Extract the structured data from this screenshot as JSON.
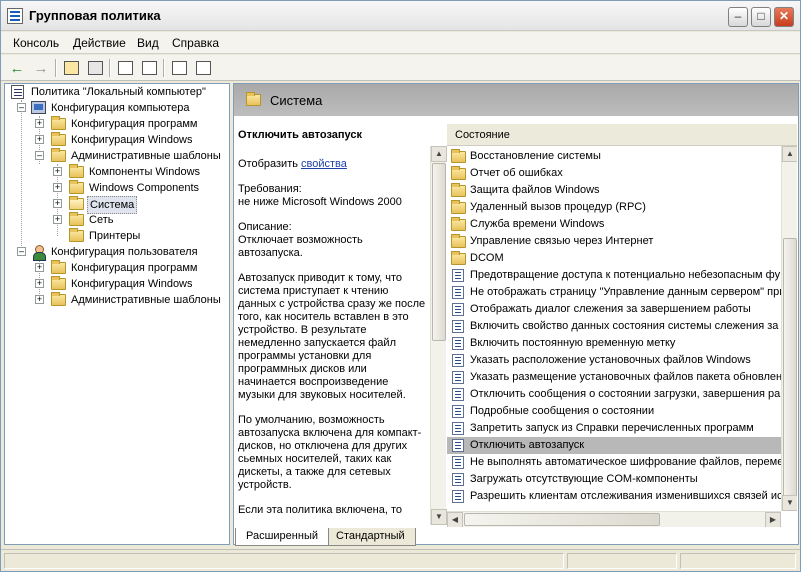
{
  "window": {
    "title": "Групповая политика"
  },
  "menu": {
    "items": [
      "Консоль",
      "Действие",
      "Вид",
      "Справка"
    ]
  },
  "tree": {
    "root": "Политика \"Локальный компьютер\"",
    "computer_config": "Конфигурация компьютера",
    "cc_programs": "Конфигурация программ",
    "cc_windows": "Конфигурация Windows",
    "cc_admin": "Административные шаблоны",
    "admin_components": "Компоненты Windows",
    "admin_windows_components": "Windows Components",
    "admin_system": "Система",
    "admin_network": "Сеть",
    "admin_printers": "Принтеры",
    "user_config": "Конфигурация пользователя",
    "uc_programs": "Конфигурация программ",
    "uc_windows": "Конфигурация Windows",
    "uc_admin": "Административные шаблоны"
  },
  "header": {
    "title": "Система"
  },
  "description": {
    "title": "Отключить автозапуск",
    "show_prefix": "Отобразить",
    "show_link": "свойства",
    "requirements_label": "Требования:",
    "requirements_value": "не ниже Microsoft Windows 2000",
    "description_label": "Описание:",
    "description_value": "Отключает возможность автозапуска.",
    "para1": "Автозапуск приводит к тому, что система приступает к чтению данных с устройства сразу же после того, как носитель вставлен в это устройство. В результате немедленно запускается файл программы установки для программных дисков или начинается воспроизведение музыки для звуковых носителей.",
    "para2": "По умолчанию, возможность автозапуска включена для компакт-дисков, но отключена для других сьемных носителей, таких как дискеты, а также для сетевых устройств.",
    "para3": "Если эта политика включена, то"
  },
  "list": {
    "column_header": "Состояние",
    "folders": [
      "Восстановление системы",
      "Отчет об ошибках",
      "Защита файлов Windows",
      "Удаленный вызов процедур (RPC)",
      "Служба времени Windows",
      "Управление связью через Интернет",
      "DCOM"
    ],
    "settings": [
      "Предотвращение доступа к потенциально небезопасным фу",
      "Не отображать страницу \"Управление данным сервером\" при",
      "Отображать диалог слежения за завершением работы",
      "Включить свойство данных состояния системы слежения за",
      "Включить постоянную временную метку",
      "Указать расположение установочных файлов Windows",
      "Указать размещение установочных файлов пакета обновлен",
      "Отключить сообщения о состоянии загрузки, завершения ра",
      "Подробные сообщения о состоянии",
      "Запретить запуск из Справки перечисленных программ",
      "Отключить автозапуск",
      "Не выполнять автоматическое шифрование файлов, переме.",
      "Загружать отсутствующие COM-компоненты",
      "Разрешить клиентам отслеживания изменившихся связей исг"
    ],
    "selected_index": 10
  },
  "tabs": {
    "extended": "Расширенный",
    "standard": "Стандартный"
  }
}
